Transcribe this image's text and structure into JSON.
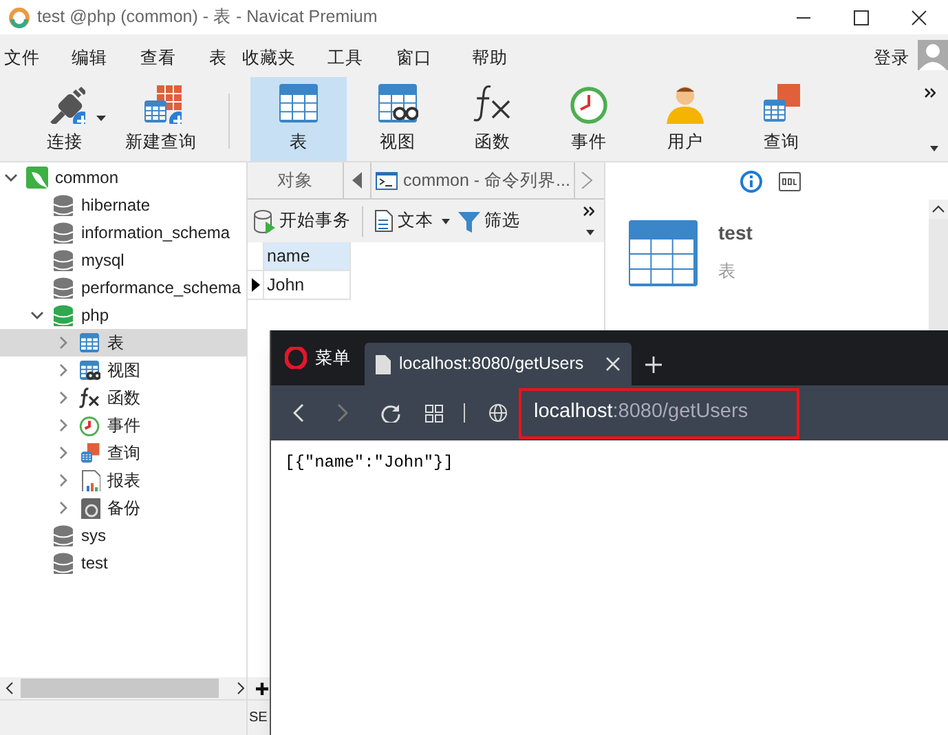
{
  "window": {
    "title": "test @php (common) - 表 - Navicat Premium"
  },
  "menu": [
    "文件",
    "编辑",
    "查看",
    "表",
    "收藏夹",
    "工具",
    "窗口",
    "帮助"
  ],
  "login": "登录",
  "toolbar": [
    {
      "label": "连接",
      "kind": "connect",
      "selected": false,
      "dropdown": true
    },
    {
      "label": "新建查询",
      "kind": "new-query",
      "selected": false,
      "dropdown": false
    },
    {
      "label": "表",
      "kind": "table",
      "selected": true,
      "dropdown": false
    },
    {
      "label": "视图",
      "kind": "view",
      "selected": false,
      "dropdown": false
    },
    {
      "label": "函数",
      "kind": "function",
      "selected": false,
      "dropdown": false
    },
    {
      "label": "事件",
      "kind": "event",
      "selected": false,
      "dropdown": false
    },
    {
      "label": "用户",
      "kind": "user",
      "selected": false,
      "dropdown": false
    },
    {
      "label": "查询",
      "kind": "query",
      "selected": false,
      "dropdown": false
    }
  ],
  "tree": [
    {
      "label": "common",
      "kind": "connection",
      "expanded": true,
      "selected": false,
      "children": [
        {
          "label": "hibernate",
          "kind": "database",
          "selected": false
        },
        {
          "label": "information_schema",
          "kind": "database",
          "selected": false
        },
        {
          "label": "mysql",
          "kind": "database",
          "selected": false
        },
        {
          "label": "performance_schema",
          "kind": "database",
          "selected": false
        },
        {
          "label": "php",
          "kind": "database",
          "expanded": true,
          "selected": false,
          "children": [
            {
              "label": "表",
              "kind": "table",
              "expanded": false,
              "selected": true
            },
            {
              "label": "视图",
              "kind": "view",
              "expanded": false,
              "selected": false
            },
            {
              "label": "函数",
              "kind": "function",
              "expanded": false,
              "selected": false
            },
            {
              "label": "事件",
              "kind": "event",
              "expanded": false,
              "selected": false
            },
            {
              "label": "查询",
              "kind": "query",
              "expanded": false,
              "selected": false
            },
            {
              "label": "报表",
              "kind": "report",
              "expanded": false,
              "selected": false
            },
            {
              "label": "备份",
              "kind": "backup",
              "expanded": false,
              "selected": false
            }
          ]
        },
        {
          "label": "sys",
          "kind": "database",
          "selected": false
        },
        {
          "label": "test",
          "kind": "database",
          "selected": false
        }
      ]
    }
  ],
  "object_tabs": [
    {
      "label": "对象",
      "kind": "objects"
    },
    {
      "label": "common - 命令列界...",
      "kind": "console"
    }
  ],
  "object_toolbar": [
    {
      "label": "开始事务",
      "kind": "transaction"
    },
    {
      "label": "文本",
      "kind": "text"
    },
    {
      "label": "筛选",
      "kind": "filter"
    }
  ],
  "grid": {
    "columns": [
      "name"
    ],
    "rows": [
      [
        "John"
      ]
    ]
  },
  "info": {
    "name": "test",
    "type": "表"
  },
  "status": "SE",
  "browser": {
    "menu": "菜单",
    "tabs": [
      {
        "title": "localhost:8080/getUsers",
        "selected": true
      }
    ],
    "address": {
      "host": "localhost",
      "rest": ":8080/getUsers",
      "highlighted": true
    },
    "body": "[{\"name\":\"John\"}]"
  }
}
